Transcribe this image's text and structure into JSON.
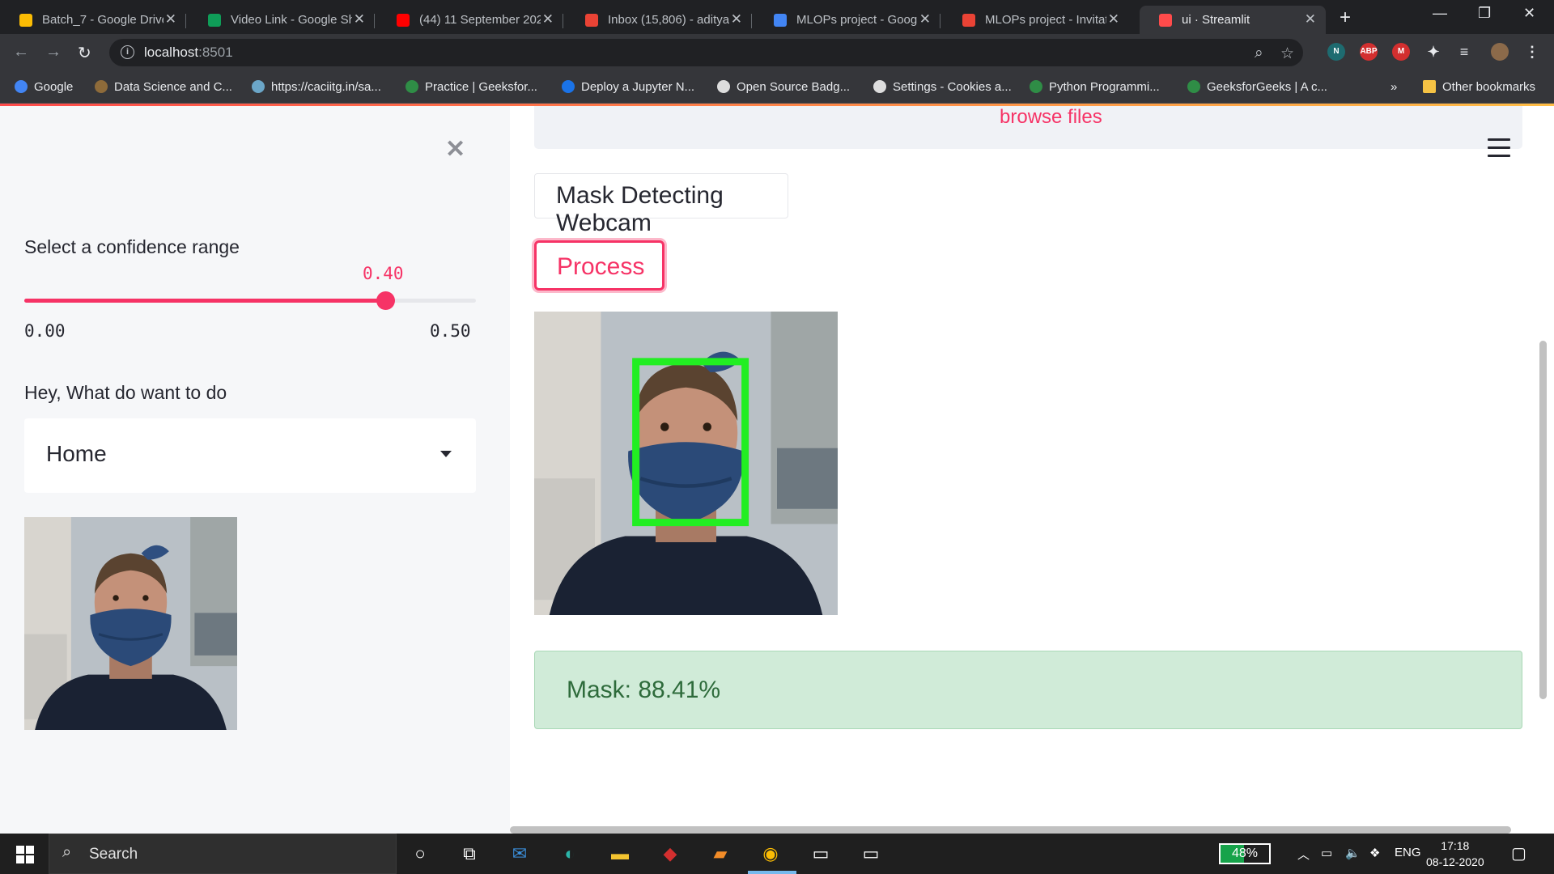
{
  "browser": {
    "tabs": [
      {
        "title": "Batch_7 - Google Drive",
        "icon": "google-drive-icon",
        "color": "#fbbc04"
      },
      {
        "title": "Video Link - Google Sh",
        "icon": "google-sheets-icon",
        "color": "#0f9d58"
      },
      {
        "title": "(44) 11 September 202",
        "icon": "youtube-icon",
        "color": "#ff0000"
      },
      {
        "title": "Inbox (15,806) - adityа",
        "icon": "gmail-icon",
        "color": "#ea4335"
      },
      {
        "title": "MLOPs project - Googl",
        "icon": "google-docs-icon",
        "color": "#4285f4"
      },
      {
        "title": "MLOPs project - Invitat",
        "icon": "gmail-icon",
        "color": "#ea4335"
      },
      {
        "title": "ui · Streamlit",
        "icon": "streamlit-icon",
        "color": "#ff4b4b"
      }
    ],
    "url_host": "localhost",
    "url_port": ":8501",
    "bookmarks": [
      {
        "label": "Google",
        "color": "#4285f4"
      },
      {
        "label": "Data Science and C...",
        "color": "#8e6b3a"
      },
      {
        "label": "https://caciitg.in/sa...",
        "color": "#6ba6c8"
      },
      {
        "label": "Practice | Geeksfor...",
        "color": "#2f8d46"
      },
      {
        "label": "Deploy a Jupyter N...",
        "color": "#1a73e8"
      },
      {
        "label": "Open Source Badg...",
        "color": "#dddddd"
      },
      {
        "label": "Settings - Cookies a...",
        "color": "#dddddd"
      },
      {
        "label": "Python Programmi...",
        "color": "#2f8d46"
      },
      {
        "label": "GeeksforGeeks | A c...",
        "color": "#2f8d46"
      }
    ],
    "other_bookmarks": "Other bookmarks"
  },
  "sidebar": {
    "confidence_label": "Select a confidence range",
    "slider": {
      "value": "0.40",
      "min": "0.00",
      "max": "0.50",
      "fraction": 0.8
    },
    "action_label": "Hey, What do want to do",
    "select_value": "Home"
  },
  "main": {
    "browse_files": "browse files",
    "webcam_button": "Mask Detecting Webcam",
    "process_button": "Process",
    "result": "Mask: 88.41%"
  },
  "taskbar": {
    "search_placeholder": "Search",
    "battery": "48%",
    "language": "ENG",
    "time": "17:18",
    "date": "08-12-2020"
  },
  "colors": {
    "accent": "#f63366",
    "success_bg": "#d0ebd8",
    "box_green": "#22ee22"
  }
}
